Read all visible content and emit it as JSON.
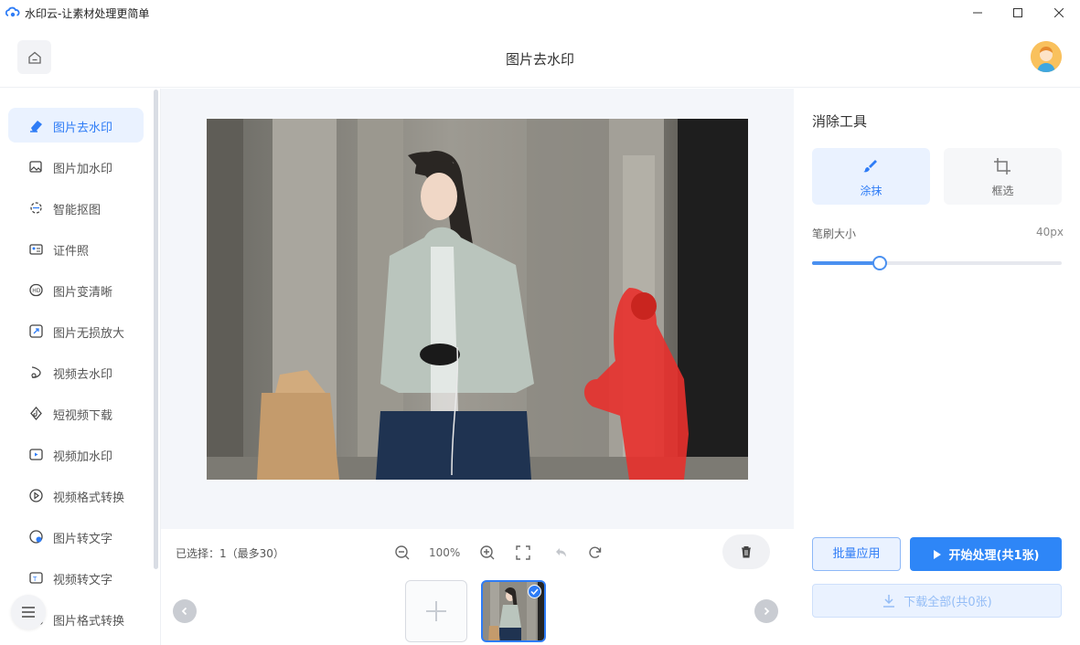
{
  "window": {
    "title": "水印云-让素材处理更简单"
  },
  "header": {
    "title": "图片去水印"
  },
  "sidebar": {
    "items": [
      {
        "label": "图片去水印",
        "icon": "eraser-icon",
        "active": true
      },
      {
        "label": "图片加水印",
        "icon": "image-add-icon"
      },
      {
        "label": "智能抠图",
        "icon": "cutout-icon"
      },
      {
        "label": "证件照",
        "icon": "id-card-icon"
      },
      {
        "label": "图片变清晰",
        "icon": "hd-icon"
      },
      {
        "label": "图片无损放大",
        "icon": "enlarge-icon"
      },
      {
        "label": "视频去水印",
        "icon": "video-eraser-icon"
      },
      {
        "label": "短视频下载",
        "icon": "tiktok-icon"
      },
      {
        "label": "视频加水印",
        "icon": "video-add-icon"
      },
      {
        "label": "视频格式转换",
        "icon": "video-convert-icon"
      },
      {
        "label": "图片转文字",
        "icon": "ocr-image-icon"
      },
      {
        "label": "视频转文字",
        "icon": "ocr-video-icon"
      },
      {
        "label": "图片格式转换",
        "icon": "image-convert-icon"
      }
    ]
  },
  "toolbar": {
    "selection": "已选择：1（最多30）",
    "zoom": "100%"
  },
  "panel": {
    "title": "消除工具",
    "modes": [
      {
        "label": "涂抹",
        "icon": "brush-icon",
        "active": true
      },
      {
        "label": "框选",
        "icon": "crop-icon",
        "active": false
      }
    ],
    "brush_label": "笔刷大小",
    "brush_value": "40px",
    "brush_level": 0.27,
    "batch_label": "批量应用",
    "start_label": "开始处理(共1张)",
    "download_label": "下载全部(共0张)"
  },
  "colors": {
    "accent": "#2e7cf6",
    "mask": "#e8302c"
  }
}
